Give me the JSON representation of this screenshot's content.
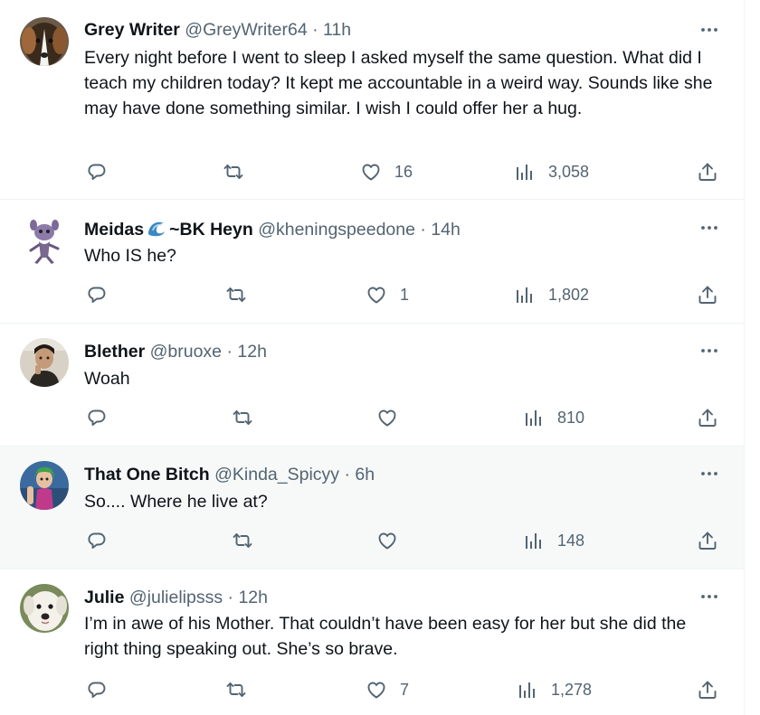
{
  "tweets": [
    {
      "name": "Grey Writer",
      "handle": "@GreyWriter64",
      "sep": "·",
      "time": "11h",
      "text": "Every night before I went to sleep I asked myself the same question. What did I teach my children today? It kept me accountable in a weird way. Sounds like she may have done something similar. I wish I could offer her a hug.",
      "likes": "16",
      "views": "3,058",
      "avatar": "dog-avatar"
    },
    {
      "name_part1": "Meidas",
      "name_emoji": "wave-emoji",
      "name_part2": "~BK Heyn",
      "handle": "@kheningspeedone",
      "sep": "·",
      "time": "14h",
      "text": "Who IS he?",
      "likes": "1",
      "views": "1,802",
      "avatar": "purple-creature-avatar"
    },
    {
      "name": "Blether",
      "handle": "@bruoxe",
      "sep": "·",
      "time": "12h",
      "text": "Woah",
      "likes": "",
      "views": "810",
      "avatar": "person-avatar"
    },
    {
      "name": "That One Bitch",
      "handle": "@Kinda_Spicyy",
      "sep": "·",
      "time": "6h",
      "text": "So.... Where he live at?",
      "likes": "",
      "views": "148",
      "avatar": "cartoon-avatar"
    },
    {
      "name": "Julie",
      "handle": "@julielipsss",
      "sep": "·",
      "time": "12h",
      "text": "I’m in awe of his Mother. That couldn’t have been easy for her but she did the right thing speaking out. She’s so brave.",
      "likes": "7",
      "views": "1,278",
      "avatar": "white-dog-avatar"
    }
  ],
  "icons": {
    "reply": "reply-icon",
    "retweet": "retweet-icon",
    "like": "heart-icon",
    "views": "views-icon",
    "share": "share-icon",
    "more": "more-icon"
  },
  "colors": {
    "text": "#0f1419",
    "secondary": "#536471",
    "highlight_bg": "#f7f9f9",
    "divider": "#eff3f4"
  }
}
